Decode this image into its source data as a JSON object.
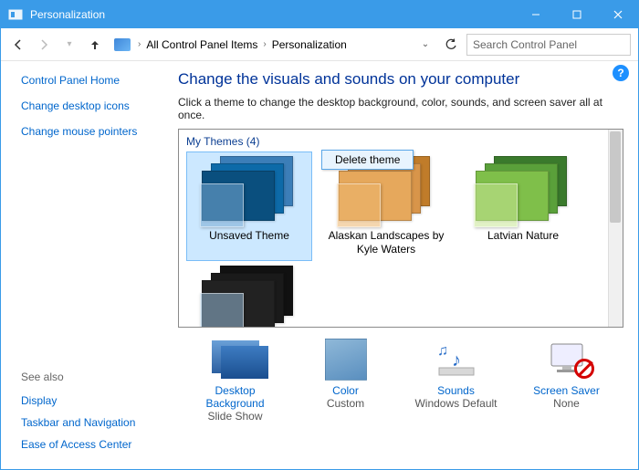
{
  "window": {
    "title": "Personalization"
  },
  "breadcrumb": {
    "item1": "All Control Panel Items",
    "item2": "Personalization"
  },
  "search": {
    "placeholder": "Search Control Panel"
  },
  "sidebar": {
    "home": "Control Panel Home",
    "link1": "Change desktop icons",
    "link2": "Change mouse pointers",
    "seealso_header": "See also",
    "seealso1": "Display",
    "seealso2": "Taskbar and Navigation",
    "seealso3": "Ease of Access Center"
  },
  "main": {
    "heading": "Change the visuals and sounds on your computer",
    "subtext": "Click a theme to change the desktop background, color, sounds, and screen saver all at once.",
    "section_label": "My Themes (4)"
  },
  "themes": [
    {
      "caption": "Unsaved Theme",
      "selected": true,
      "colors": [
        "#3c7eb8",
        "#0d6aa8",
        "#0a4f7e"
      ],
      "overlay": "rgba(120,170,210,0.55)"
    },
    {
      "caption": "Alaskan Landscapes by Kyle Waters",
      "selected": false,
      "colors": [
        "#c07c2a",
        "#d8954a",
        "#e6a85c"
      ],
      "overlay": "rgba(235,180,110,0.55)"
    },
    {
      "caption": "Latvian Nature",
      "selected": false,
      "colors": [
        "#3a7a2c",
        "#5aa03a",
        "#7fbf4a"
      ],
      "overlay": "rgba(200,230,150,0.55)"
    },
    {
      "caption": "",
      "selected": false,
      "colors": [
        "#111",
        "#1a1a1a",
        "#222"
      ],
      "overlay": "rgba(150,185,215,0.55)"
    }
  ],
  "context_menu": {
    "item1": "Delete theme"
  },
  "bottom": {
    "bg_label": "Desktop Background",
    "bg_value": "Slide Show",
    "color_label": "Color",
    "color_value": "Custom",
    "sounds_label": "Sounds",
    "sounds_value": "Windows Default",
    "ss_label": "Screen Saver",
    "ss_value": "None"
  }
}
